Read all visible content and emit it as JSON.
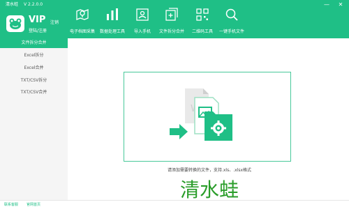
{
  "app": {
    "title": "清水蛙",
    "version": "V 2.2.0.0"
  },
  "window": {
    "minimize_glyph": "—",
    "close_glyph": "✕"
  },
  "account": {
    "vip_label": "VIP",
    "register_label": "注销",
    "login_label": "登陆/注册"
  },
  "toolbar": [
    {
      "label": "电子档图采集",
      "icon": "map-pin-icon"
    },
    {
      "label": "数据处理工具",
      "icon": "bar-chart-icon"
    },
    {
      "label": "导入手机",
      "icon": "contact-card-icon"
    },
    {
      "label": "文件拆分合并",
      "icon": "split-merge-icon"
    },
    {
      "label": "二维码工具",
      "icon": "qr-code-icon"
    },
    {
      "label": "一键手机文件",
      "icon": "search-icon"
    }
  ],
  "sidebar": {
    "items": [
      {
        "label": "文件拆分合并",
        "active": true
      },
      {
        "label": "Excel拆分",
        "active": false
      },
      {
        "label": "Excel合并",
        "active": false
      },
      {
        "label": "TXT/CSV拆分",
        "active": false
      },
      {
        "label": "TXT/CSV合并",
        "active": false
      }
    ]
  },
  "main": {
    "hint": "请添加需要转换的文件，支持.xls、.xlsx格式",
    "brand": "清水蛙"
  },
  "footer": {
    "left_link": "联系客服",
    "right_link": "官网首页"
  },
  "colors": {
    "accent": "#1fbf86",
    "brand_text": "#2a9d2a",
    "sidebar_bg": "#f5f5f5"
  }
}
